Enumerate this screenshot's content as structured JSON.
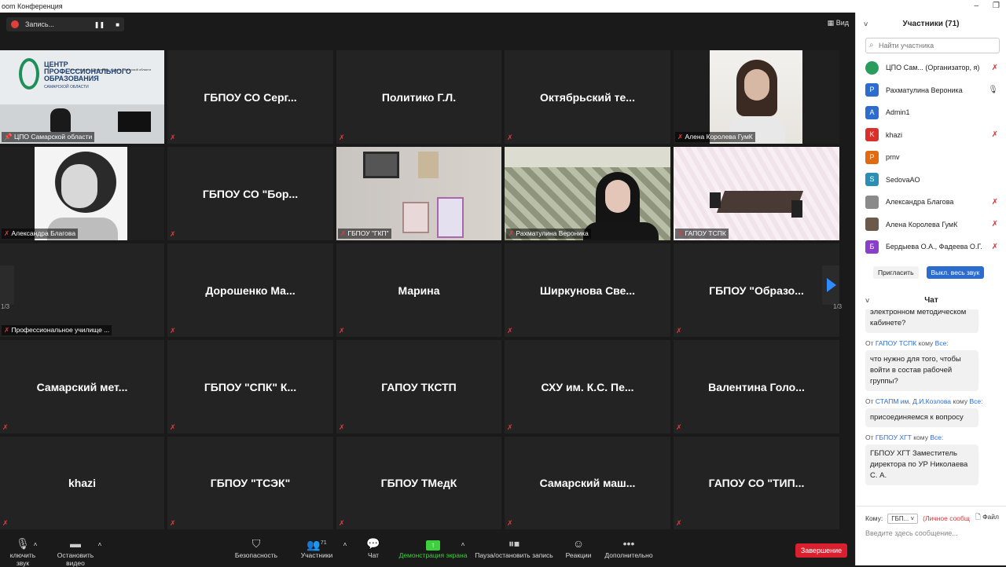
{
  "window": {
    "title": "oom Конференция",
    "min": "–",
    "max": "❐"
  },
  "recording": {
    "label": "Запись...",
    "pause": "❚❚",
    "stop": "■"
  },
  "view": {
    "label": "Вид",
    "icon": "grid-view-icon"
  },
  "page": {
    "left": "1/3",
    "right": "1/3"
  },
  "tiles": [
    {
      "name": "ЦПО Самарской области",
      "type": "video",
      "pinned": true
    },
    {
      "name": "ГБПОУ СО Серг...",
      "type": "name"
    },
    {
      "name": "Политико Г.Л.",
      "type": "name"
    },
    {
      "name": "Октябрьский те...",
      "type": "name"
    },
    {
      "name": "Алена Королева ГумК",
      "type": "video"
    },
    {
      "name": "Александра Благова",
      "type": "video"
    },
    {
      "name": "ГБПОУ СО \"Бор...",
      "type": "name"
    },
    {
      "name": "ГБПОУ \"ГКП\"",
      "type": "video"
    },
    {
      "name": "Рахматулина Вероника",
      "type": "video",
      "active": true
    },
    {
      "name": "ГАПОУ ТСПК",
      "type": "video"
    },
    {
      "name": "Профессиональное училище ...",
      "type": "label"
    },
    {
      "name": "Дорошенко Ма...",
      "type": "name"
    },
    {
      "name": "Марина",
      "type": "name"
    },
    {
      "name": "Ширкунова Све...",
      "type": "name"
    },
    {
      "name": "ГБПОУ \"Образо...",
      "type": "name"
    },
    {
      "name": "Самарский мет...",
      "type": "name"
    },
    {
      "name": "ГБПОУ \"СПК\" К...",
      "type": "name"
    },
    {
      "name": "ГАПОУ ТКСТП",
      "type": "name"
    },
    {
      "name": "СХУ им. К.С. Пе...",
      "type": "name"
    },
    {
      "name": "Валентина Голо...",
      "type": "name"
    },
    {
      "name": "khazi",
      "type": "name"
    },
    {
      "name": "ГБПОУ \"ТСЭК\"",
      "type": "name"
    },
    {
      "name": "ГБПОУ ТМедК",
      "type": "name"
    },
    {
      "name": "Самарский маш...",
      "type": "name"
    },
    {
      "name": "ГАПОУ СО \"ТИП...",
      "type": "name"
    }
  ],
  "cpo_sign": {
    "line1": "ЦЕНТР",
    "line2": "ПРОФЕССИОНАЛЬНОГО",
    "line3": "ОБРАЗОВАНИЯ",
    "sub": "САМАРСКОЙ ОБЛАСТИ",
    "small": "Министерство образования и науки Самарской области"
  },
  "toolbar": {
    "mic": "ключить звук",
    "video": "Остановить видео",
    "security": "Безопасность",
    "participants": "Участники",
    "participants_count": "71",
    "chat": "Чат",
    "share": "Демонстрация экрана",
    "record": "Пауза/остановить запись",
    "reactions": "Реакции",
    "more": "Дополнительно",
    "end": "Завершение"
  },
  "participants": {
    "title": "Участники (71)",
    "search_placeholder": "Найти участника",
    "list": [
      {
        "initial": "",
        "name": "ЦПО Сам... (Организатор, я)",
        "color": "#2a9d5c",
        "mic": "muted-red"
      },
      {
        "initial": "Р",
        "name": "Рахматулина Вероника",
        "color": "#2d6ccf",
        "mic": "on"
      },
      {
        "initial": "A",
        "name": "Admin1",
        "color": "#2d6ccf",
        "mic": "none"
      },
      {
        "initial": "K",
        "name": "khazi",
        "color": "#d9302a",
        "mic": "muted"
      },
      {
        "initial": "P",
        "name": "prnv",
        "color": "#e06b12",
        "mic": "none"
      },
      {
        "initial": "S",
        "name": "SedovaAO",
        "color": "#2b8fb3",
        "mic": "none"
      },
      {
        "initial": "",
        "name": "Александра Благова",
        "color": "#8a8a8a",
        "mic": "muted"
      },
      {
        "initial": "",
        "name": "Алена Королева ГумК",
        "color": "#6b5a4a",
        "mic": "muted"
      },
      {
        "initial": "Б",
        "name": "Бердыева О.А., Фадеева О.Г.",
        "color": "#8a3fc9",
        "mic": "muted"
      }
    ],
    "invite": "Пригласить",
    "mute_all": "Выкл. весь звук"
  },
  "chat": {
    "title": "Чат",
    "messages": [
      {
        "from": "",
        "to": "",
        "text": "электронном методическом кабинете?",
        "partial": true
      },
      {
        "from": "ГАПОУ ТСПК",
        "to": "Все:",
        "text": "что нужно для того, чтобы войти в состав рабочей группы?"
      },
      {
        "from": "СТАПМ им. Д.И.Козлова",
        "to": "Все:",
        "text": "присоединяемся к вопросу"
      },
      {
        "from": "ГБПОУ ХГТ",
        "to": "Все:",
        "text": "ГБПОУ ХГТ Заместитель директора по УР Николаева С. А."
      }
    ],
    "from_prefix": "От",
    "to_prefix": "кому",
    "to_label": "Кому:",
    "to_value": "ГБП...",
    "private": "(Личное сообщ",
    "file": "Файл",
    "compose_placeholder": "Введите здесь сообщение..."
  }
}
